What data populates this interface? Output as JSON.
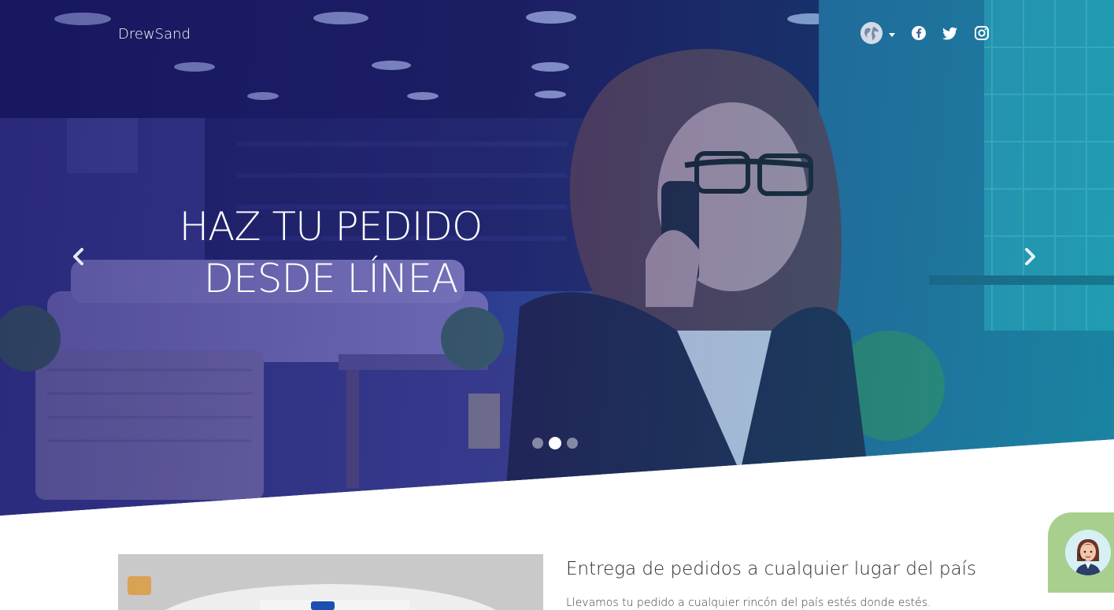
{
  "brand": {
    "name": "DrewSand"
  },
  "nav": {
    "icons": [
      "globe-icon",
      "chevron-down-icon",
      "facebook-icon",
      "twitter-icon",
      "instagram-icon"
    ]
  },
  "hero": {
    "title_line1": "HAZ TU PEDIDO",
    "title_line2": "DESDE LÍNEA",
    "slide_count": 3,
    "active_slide": 2
  },
  "feature": {
    "title": "Entrega de pedidos a cualquier lugar del país",
    "text": "Llevamos tu pedido a cualquier rincón del país estés donde estés."
  },
  "colors": {
    "hero_overlay_start": "#1c1f6e",
    "hero_overlay_end": "#1aa6b0",
    "chat_widget": "#a9cf8e"
  }
}
